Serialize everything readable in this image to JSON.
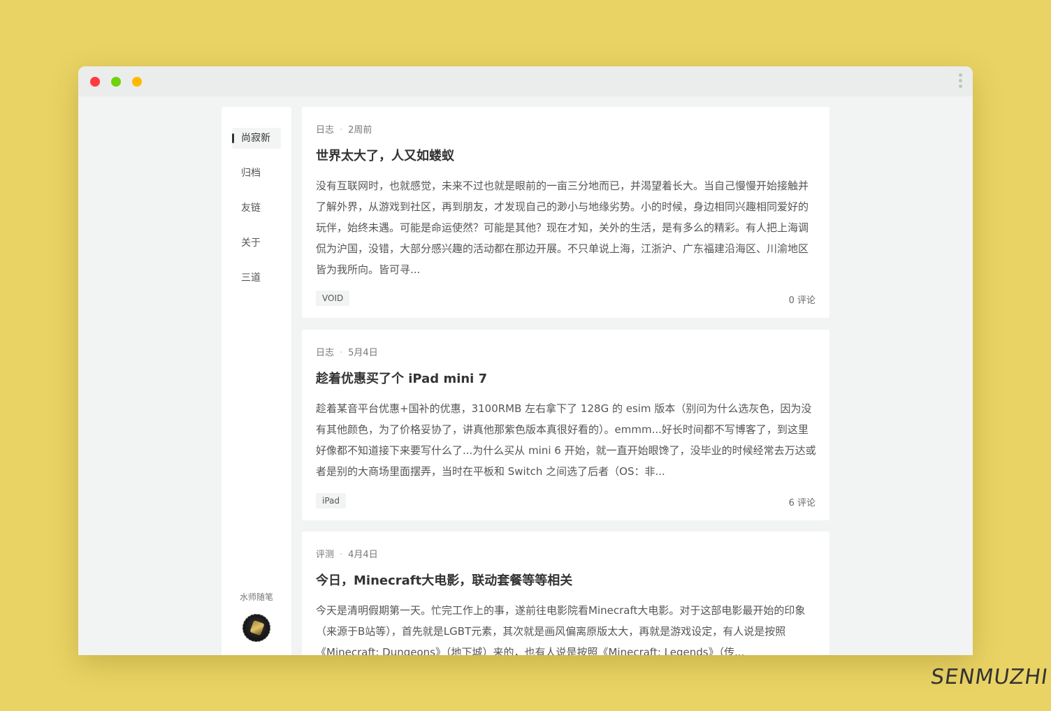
{
  "nav": {
    "items": [
      {
        "label": "尚寂新"
      },
      {
        "label": "归档"
      },
      {
        "label": "友链"
      },
      {
        "label": "关于"
      },
      {
        "label": "三道"
      }
    ],
    "site_name": "水师随笔"
  },
  "posts": [
    {
      "category": "日志",
      "date": "2周前",
      "title": "世界太大了，人又如蝼蚁",
      "excerpt": "没有互联网时，也就感觉，未来不过也就是眼前的一亩三分地而已，并渴望着长大。当自己慢慢开始接触并了解外界，从游戏到社区，再到朋友，才发现自己的渺小与地缘劣势。小的时候，身边相同兴趣相同爱好的玩伴，始终未遇。可能是命运使然？可能是其他？现在才知，关外的生活，是有多么的精彩。有人把上海调侃为沪国，没错，大部分感兴趣的活动都在那边开展。不只单说上海，江浙沪、广东福建沿海区、川渝地区皆为我所向。皆可寻...",
      "tag": "VOID",
      "comments": "0 评论"
    },
    {
      "category": "日志",
      "date": "5月4日",
      "title": "趁着优惠买了个 iPad mini 7",
      "excerpt": "趁着某音平台优惠+国补的优惠，3100RMB 左右拿下了 128G 的 esim 版本（别问为什么选灰色，因为没有其他颜色，为了价格妥协了，讲真他那紫色版本真很好看的）。emmm...好长时间都不写博客了，到这里好像都不知道接下来要写什么了...为什么买从 mini 6 开始，就一直开始眼馋了，没毕业的时候经常去万达或者是别的大商场里面摆弄，当时在平板和 Switch 之间选了后者（OS：非...",
      "tag": "iPad",
      "comments": "6 评论"
    },
    {
      "category": "评测",
      "date": "4月4日",
      "title": "今日，Minecraft大电影，联动套餐等等相关",
      "excerpt": "今天是清明假期第一天。忙完工作上的事，遂前往电影院看Minecraft大电影。对于这部电影最开始的印象（来源于B站等），首先就是LGBT元素，其次就是画风偏离原版太大，再就是游戏设定，有人说是按照《Minecraft: Dungeons》（地下城）来的，也有人说是按照《Minecraft: Legends》（传..."
    }
  ],
  "watermark": "SENMUZHI"
}
